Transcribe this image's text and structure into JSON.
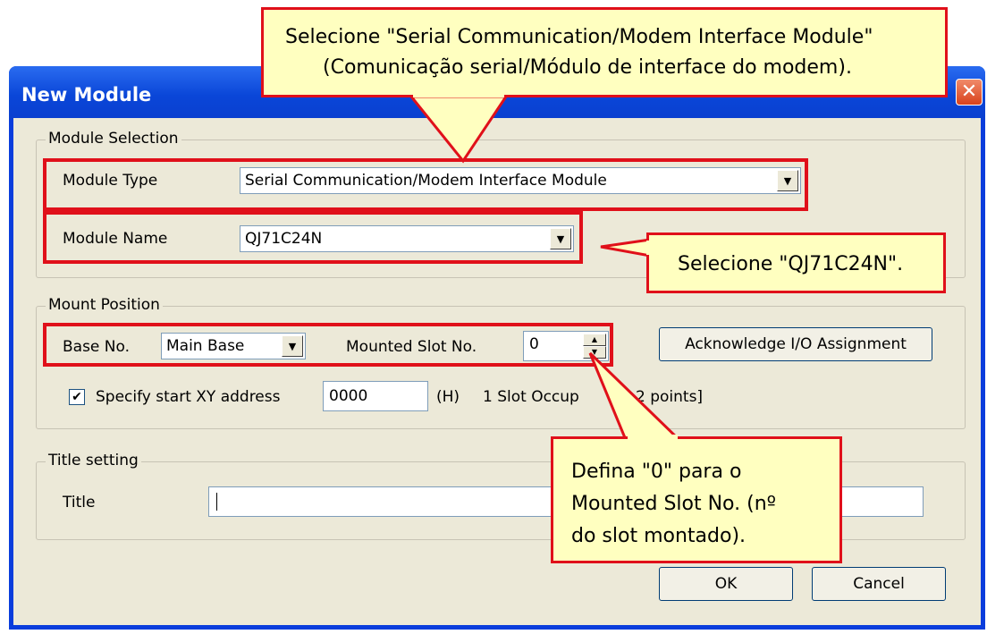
{
  "window": {
    "title": "New Module",
    "close_glyph": "✕"
  },
  "module_selection": {
    "group_label": "Module Selection",
    "module_type_label": "Module Type",
    "module_type_value": "Serial Communication/Modem Interface Module",
    "module_name_label": "Module Name",
    "module_name_value": "QJ71C24N"
  },
  "mount_position": {
    "group_label": "Mount Position",
    "base_no_label": "Base No.",
    "base_no_value": "Main Base",
    "mounted_slot_label": "Mounted Slot No.",
    "mounted_slot_value": "0",
    "ack_button_label": "Acknowledge I/O Assignment",
    "specify_checkbox_checked": true,
    "specify_label": "Specify start XY address",
    "start_xy_value": "0000",
    "hex_suffix": "(H)",
    "slot_occupy_text": "1 Slot Occup",
    "slot_occupy_tail": "2 points]"
  },
  "title_setting": {
    "group_label": "Title setting",
    "title_label": "Title",
    "title_value": ""
  },
  "buttons": {
    "ok_label": "OK",
    "cancel_label": "Cancel"
  },
  "callouts": {
    "module_type_line1": "Selecione \"Serial Communication/Modem Interface Module\"",
    "module_type_line2": "(Comunicação serial/Módulo de interface do modem).",
    "module_name": "Selecione \"QJ71C24N\".",
    "slot_line1": "Defina \"0\" para o",
    "slot_line2": "Mounted Slot No. (nº",
    "slot_line3": "do slot montado)."
  },
  "colors": {
    "titlebar": "#0a46d8",
    "highlight": "#e0101a",
    "callout_fill": "#ffffc0",
    "dialog_face": "#ece9d8"
  }
}
